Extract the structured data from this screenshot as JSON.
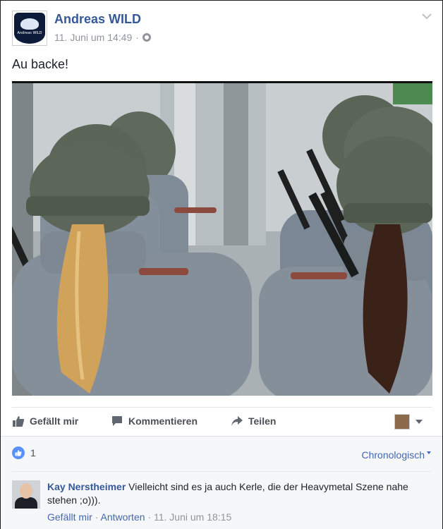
{
  "post": {
    "author": "Andreas WILD",
    "timestamp": "11. Juni um 14:49",
    "meta_separator": "·",
    "privacy_icon": "globe-icon",
    "menu_icon": "chevron-down-icon",
    "text": "Au backe!",
    "avatar_lines": [
      "Andreas WILD"
    ]
  },
  "actions": {
    "like": "Gefällt mir",
    "comment": "Kommentieren",
    "share": "Teilen"
  },
  "reactions": {
    "count": "1",
    "sort": "Chronologisch"
  },
  "comments": [
    {
      "author": "Kay Nerstheimer",
      "text": "Vielleicht sind es ja auch Kerle, die der Heavymetal Szene nahe stehen ;o))).",
      "like": "Gefällt mir",
      "reply": "Antworten",
      "separator": "·",
      "timestamp": "11. Juni um 18:15"
    }
  ],
  "colors": {
    "link": "#365899",
    "action_blue": "#4267b2",
    "muted": "#90949c",
    "panel_bg": "#f6f7f9"
  }
}
